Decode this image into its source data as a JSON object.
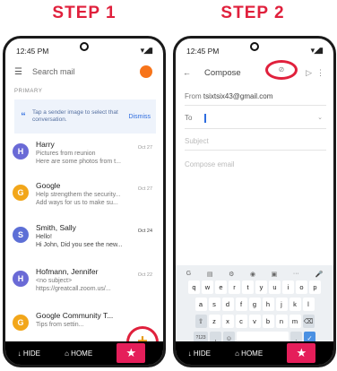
{
  "steps": {
    "step1": "STEP 1",
    "step2": "STEP 2"
  },
  "status": {
    "time": "12:45 PM",
    "sys": "▾◢▮"
  },
  "inbox": {
    "search_placeholder": "Search mail",
    "section": "PRIMARY",
    "tip_text": "Tap a sender image to select that conversation.",
    "tip_dismiss": "Dismiss",
    "mails": [
      {
        "initial": "H",
        "color": "#6a6ad6",
        "sender": "Harry",
        "subject": "Pictures from reunion",
        "snippet": "Here are some photos from t...",
        "date": "Oct 27"
      },
      {
        "initial": "G",
        "color": "#f2a61a",
        "sender": "Google",
        "subject": "Help strengthem the security...",
        "snippet": "Add ways for us to make su...",
        "date": "Oct 27"
      },
      {
        "initial": "S",
        "color": "#5d6fd6",
        "sender": "Smith, Sally",
        "subject": "Hello!",
        "snippet": "Hi John, Did you see the new...",
        "date": "Oct 24"
      },
      {
        "initial": "H",
        "color": "#6a6ad6",
        "sender": "Hofmann, Jennifer",
        "subject": "<no subject>",
        "snippet": "https://greatcall.zoom.us/...",
        "date": "Oct 22"
      },
      {
        "initial": "G",
        "color": "#f2a61a",
        "sender": "Google Community T...",
        "subject": "Tips from settin...",
        "snippet": "",
        "date": ""
      }
    ],
    "fab": "+"
  },
  "bottombar": {
    "hide": "↓ HIDE",
    "home": "⌂ HOME",
    "star": "★"
  },
  "compose": {
    "back": "←",
    "title": "Compose",
    "clip": "⊘",
    "send": "▷",
    "more": "⋮",
    "from_label": "From",
    "from_value": "tsixtsix43@gmail.com",
    "to_label": "To",
    "subject_placeholder": "Subject",
    "body_placeholder": "Compose email"
  },
  "keyboard": {
    "tools": [
      "G",
      "▤",
      "⚙",
      "◉",
      "▣",
      "···",
      "🎤"
    ],
    "row1": [
      "q",
      "w",
      "e",
      "r",
      "t",
      "y",
      "u",
      "i",
      "o",
      "p"
    ],
    "row2": [
      "a",
      "s",
      "d",
      "f",
      "g",
      "h",
      "j",
      "k",
      "l"
    ],
    "row3": [
      "⇧",
      "z",
      "x",
      "c",
      "v",
      "b",
      "n",
      "m",
      "⌫"
    ],
    "row4": [
      "?123",
      ",",
      "☺",
      " ",
      ".",
      "✓"
    ]
  }
}
